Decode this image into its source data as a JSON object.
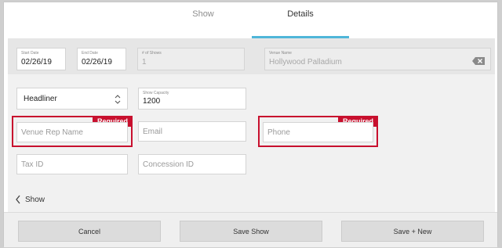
{
  "tabs": [
    {
      "label": "Show",
      "active": false
    },
    {
      "label": "Details",
      "active": true
    }
  ],
  "top_fields": {
    "start_date": {
      "label": "Start Date",
      "value": "02/26/19"
    },
    "end_date": {
      "label": "End Date",
      "value": "02/26/19"
    },
    "num_shows": {
      "label": "# of Shows",
      "value": "1"
    },
    "venue_name": {
      "label": "Venue Name",
      "value": "Hollywood Palladium"
    }
  },
  "billing_select": {
    "value": "Headliner"
  },
  "show_capacity": {
    "label": "Show Capacity",
    "value": "1200"
  },
  "venue_rep_name": {
    "placeholder": "Venue Rep Name",
    "required_label": "Required"
  },
  "email": {
    "placeholder": "Email"
  },
  "phone": {
    "placeholder": "Phone",
    "required_label": "Required"
  },
  "tax_id": {
    "placeholder": "Tax ID"
  },
  "concession_id": {
    "placeholder": "Concession ID"
  },
  "back_link": {
    "label": "Show"
  },
  "buttons": {
    "cancel": "Cancel",
    "save_show": "Save Show",
    "save_new": "Save + New"
  },
  "colors": {
    "accent": "#4fb6d9",
    "required": "#c8102e"
  },
  "icons": [
    "chevron-left-icon",
    "select-chevron-icon",
    "clear-input-icon"
  ]
}
